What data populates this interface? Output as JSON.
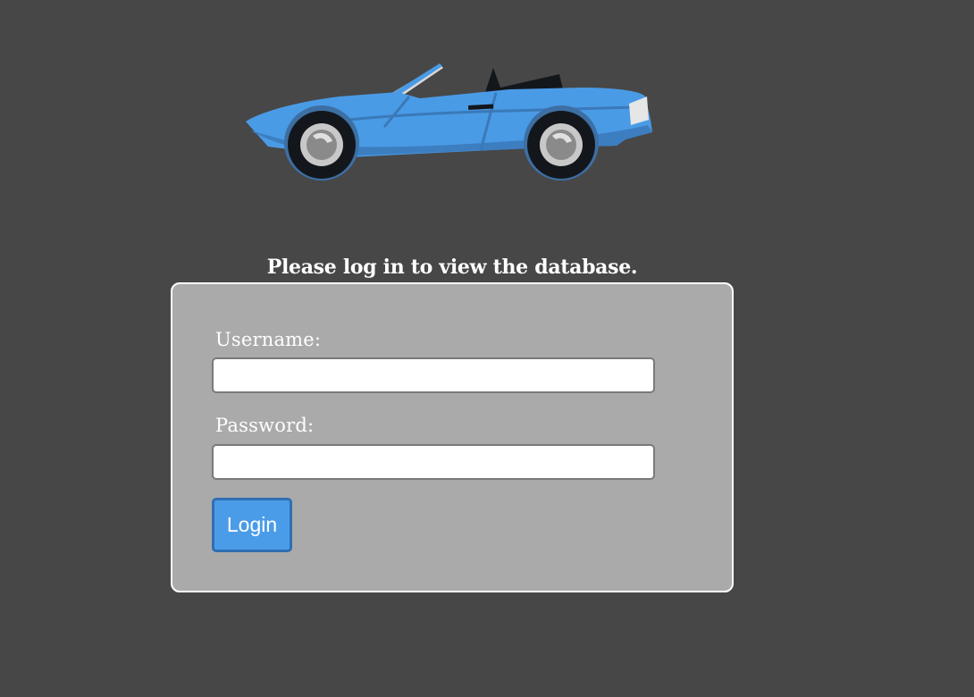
{
  "header": {
    "logo_icon": "convertible-car-icon",
    "prompt": "Please log in to view the database."
  },
  "login_form": {
    "username_label": "Username:",
    "username_value": "",
    "password_label": "Password:",
    "password_value": "",
    "submit_label": "Login"
  },
  "colors": {
    "background": "#474747",
    "panel": "#aaaaaa",
    "panel_border": "#ffffff",
    "button": "#4b9ce8",
    "button_border": "#2f6fb3",
    "car_body": "#4a9be6"
  }
}
